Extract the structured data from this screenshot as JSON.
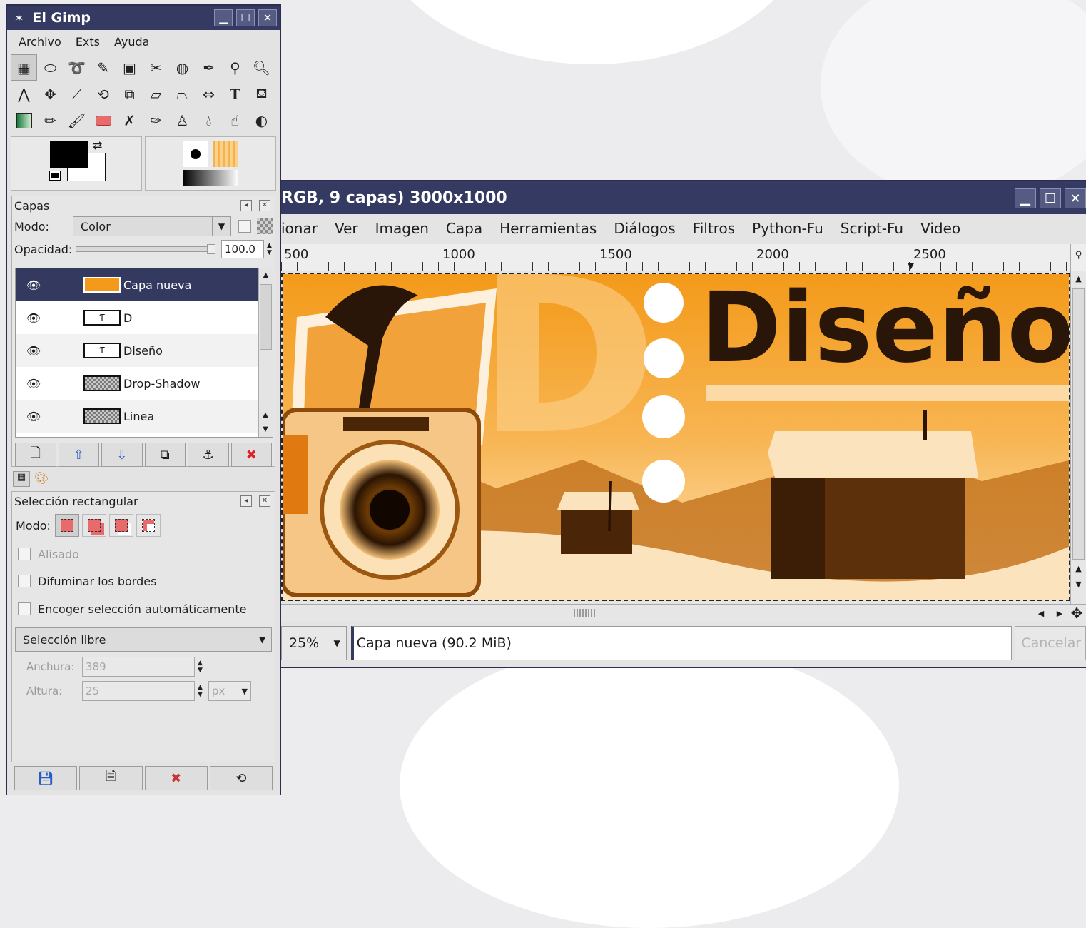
{
  "toolbox": {
    "title": "El Gimp",
    "menu": [
      "Archivo",
      "Exts",
      "Ayuda"
    ],
    "tools": [
      "rect-select-icon",
      "ellipse-select-icon",
      "lasso-icon",
      "fuzzy-select-icon",
      "color-select-icon",
      "scissors-icon",
      "foreground-select-icon",
      "paths-icon",
      "color-picker-icon",
      "zoom-icon",
      "measure-icon",
      "move-icon",
      "crop-icon",
      "rotate-icon",
      "scale-icon",
      "shear-icon",
      "perspective-icon",
      "flip-icon",
      "text-icon",
      "bucket-fill-icon",
      "blend-icon",
      "pencil-icon",
      "paintbrush-icon",
      "eraser-icon",
      "airbrush-icon",
      "ink-icon",
      "clone-icon",
      "convolve-icon",
      "smudge-icon",
      "dodge-burn-icon"
    ]
  },
  "layers": {
    "title": "Capas",
    "mode_label": "Modo:",
    "mode_value": "Color",
    "opacity_label": "Opacidad:",
    "opacity_value": "100.0",
    "items": [
      {
        "name": "Capa nueva",
        "thumb": "orange"
      },
      {
        "name": "D",
        "thumb": "text"
      },
      {
        "name": "Diseño",
        "thumb": "text"
      },
      {
        "name": "Drop-Shadow",
        "thumb": "checker"
      },
      {
        "name": "Linea",
        "thumb": "checker"
      }
    ]
  },
  "tool_options": {
    "title": "Selección rectangular",
    "mode_label": "Modo:",
    "antialias": "Alisado",
    "feather": "Difuminar los bordes",
    "autoshrink": "Encoger selección automáticamente",
    "shape": "Selección libre",
    "width_label": "Anchura:",
    "width_value": "389",
    "height_label": "Altura:",
    "height_value": "25",
    "unit": "px"
  },
  "image_window": {
    "title": "RGB, 9 capas) 3000x1000",
    "menu": [
      "ionar",
      "Ver",
      "Imagen",
      "Capa",
      "Herramientas",
      "Diálogos",
      "Filtros",
      "Python-Fu",
      "Script-Fu",
      "Video"
    ],
    "ruler_labels": [
      "500",
      "1000",
      "1500",
      "2000",
      "2500"
    ],
    "canvas_text": "Diseño",
    "canvas_letter": "D",
    "zoom": "25%",
    "status": "Capa nueva (90.2 MiB)",
    "cancel": "Cancelar"
  },
  "colors": {
    "title_bar": "#353a63",
    "accent_orange": "#f39a1a",
    "selection_row": "#34395f"
  }
}
